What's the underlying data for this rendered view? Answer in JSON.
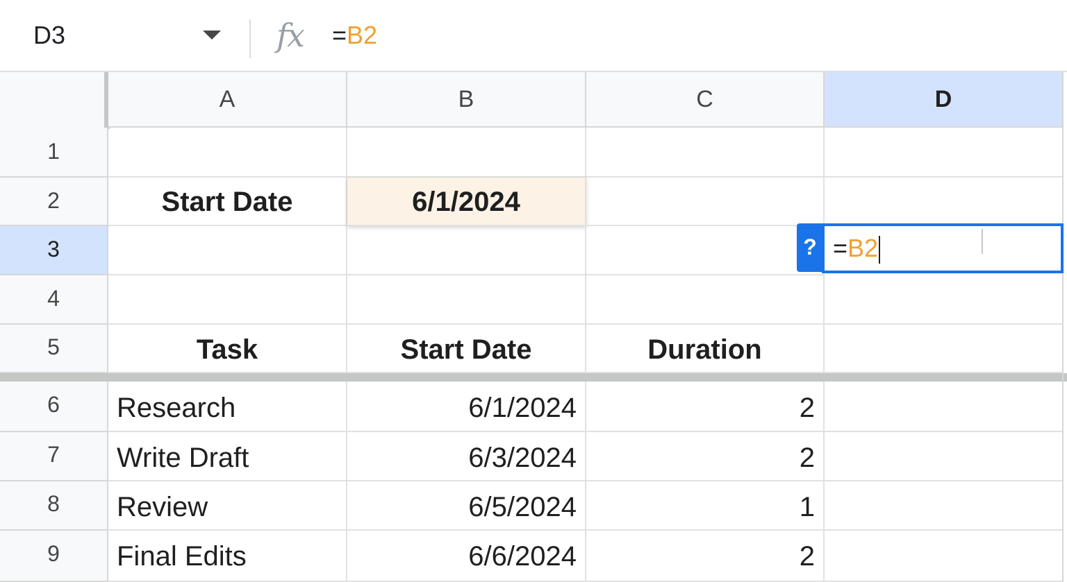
{
  "formula_bar": {
    "name_box": "D3",
    "fx_icon": "fx-icon",
    "formula_prefix": "=",
    "formula_ref": "B2"
  },
  "columns": [
    "A",
    "B",
    "C",
    "D"
  ],
  "rows": [
    "1",
    "2",
    "3",
    "4",
    "5",
    "6",
    "7",
    "8",
    "9"
  ],
  "cells": {
    "a2": "Start Date",
    "b2": "6/1/2024",
    "a5": "Task",
    "b5": "Start Date",
    "c5": "Duration",
    "tasks": [
      {
        "task": "Research",
        "start": "6/1/2024",
        "duration": "2"
      },
      {
        "task": "Write Draft",
        "start": "6/3/2024",
        "duration": "2"
      },
      {
        "task": "Review",
        "start": "6/5/2024",
        "duration": "1"
      },
      {
        "task": "Final Edits",
        "start": "6/6/2024",
        "duration": "2"
      }
    ]
  },
  "editor": {
    "help_badge": "?",
    "prefix": "=",
    "ref": "B2"
  },
  "colors": {
    "selection_blue": "#1a73e8",
    "header_selected": "#d3e3fd",
    "reference_orange": "#f0a030",
    "highlight_cell": "#fdf2e6"
  }
}
